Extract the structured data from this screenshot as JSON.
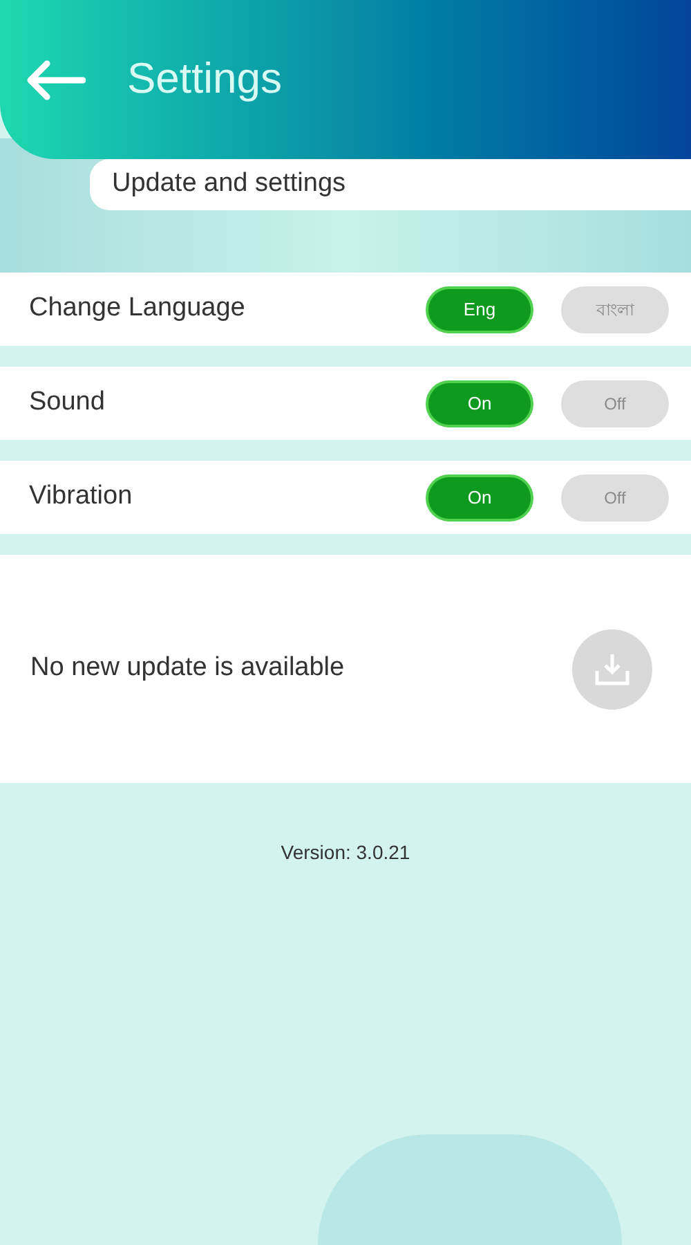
{
  "header": {
    "title": "Settings"
  },
  "section_title": "Update and settings",
  "settings": [
    {
      "label": "Change Language",
      "options": [
        {
          "label": "Eng",
          "selected": true
        },
        {
          "label": "বাংলা",
          "selected": false
        }
      ]
    },
    {
      "label": "Sound",
      "options": [
        {
          "label": "On",
          "selected": true
        },
        {
          "label": "Off",
          "selected": false
        }
      ]
    },
    {
      "label": "Vibration",
      "options": [
        {
          "label": "On",
          "selected": true
        },
        {
          "label": "Off",
          "selected": false
        }
      ]
    }
  ],
  "update": {
    "message": "No new update is available",
    "download_disabled": true
  },
  "version": "Version: 3.0.21"
}
